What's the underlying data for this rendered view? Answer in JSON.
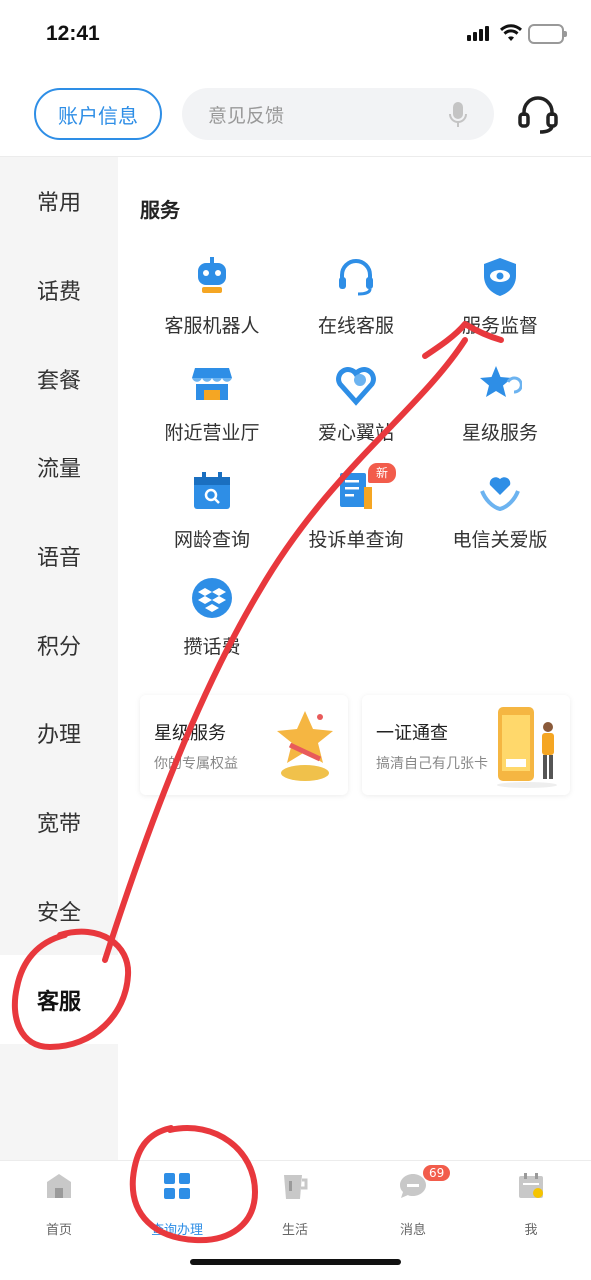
{
  "status_bar": {
    "time": "12:41"
  },
  "header": {
    "account_button": "账户信息",
    "search_placeholder": "意见反馈"
  },
  "sidebar": {
    "items": [
      "常用",
      "话费",
      "套餐",
      "流量",
      "语音",
      "积分",
      "办理",
      "宽带",
      "安全",
      "客服"
    ],
    "active": "客服"
  },
  "main": {
    "section_title": "服务",
    "services": [
      {
        "label": "客服机器人",
        "icon": "robot-icon"
      },
      {
        "label": "在线客服",
        "icon": "headset-icon"
      },
      {
        "label": "服务监督",
        "icon": "shield-eye-icon"
      },
      {
        "label": "附近营业厅",
        "icon": "store-icon"
      },
      {
        "label": "爱心翼站",
        "icon": "heart-pin-icon"
      },
      {
        "label": "星级服务",
        "icon": "star-icon"
      },
      {
        "label": "网龄查询",
        "icon": "calendar-search-icon"
      },
      {
        "label": "投诉单查询",
        "icon": "document-icon",
        "badge": "新"
      },
      {
        "label": "电信关爱版",
        "icon": "heart-hands-icon"
      },
      {
        "label": "攒话费",
        "icon": "dropbox-icon"
      }
    ],
    "cards": [
      {
        "title": "星级服务",
        "subtitle": "你的专属权益",
        "art": "trophy-art"
      },
      {
        "title": "一证通查",
        "subtitle": "搞清自己有几张卡",
        "art": "phone-person-art"
      }
    ]
  },
  "tabbar": {
    "tabs": [
      {
        "label": "首页",
        "icon": "home-icon"
      },
      {
        "label": "查询办理",
        "icon": "grid-icon"
      },
      {
        "label": "生活",
        "icon": "cup-icon"
      },
      {
        "label": "消息",
        "icon": "chat-icon",
        "badge": "69"
      },
      {
        "label": "我",
        "icon": "calendar-sign-icon"
      }
    ],
    "active": "查询办理"
  },
  "colors": {
    "accent": "#2e8ee6",
    "badge": "#f25c4b",
    "annotation": "#e8383d"
  }
}
